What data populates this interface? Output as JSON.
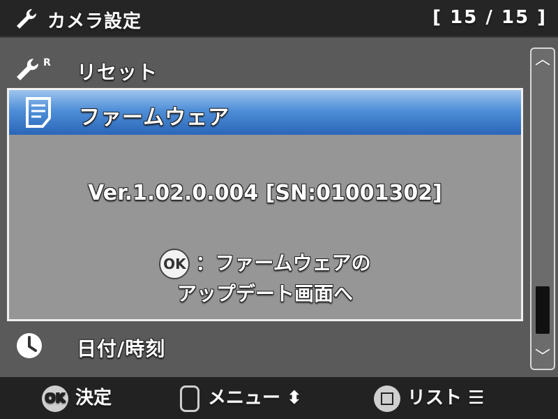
{
  "header": {
    "title": "カメラ設定",
    "page_indicator": "[ 15 / 15 ]"
  },
  "menu": {
    "items": [
      {
        "label": "リセット",
        "icon": "wrench-reset-icon"
      },
      {
        "label": "ファームウェア",
        "icon": "firmware-icon",
        "selected": true
      },
      {
        "label": "日付/時刻",
        "icon": "clock-icon"
      }
    ],
    "superscript_R": "R"
  },
  "detail": {
    "version": "Ver.1.02.0.004 [SN:01001302]",
    "ok_badge": "OK",
    "hint_line1": "：ファームウェアの",
    "hint_line2": "アップデート画面へ"
  },
  "footer": {
    "ok_badge": "OK",
    "ok_label": "決定",
    "menu_label": "メニュー",
    "menu_arrow": "⬍",
    "list_label": "リスト",
    "list_icon": "☰"
  },
  "colors": {
    "highlight": "#4f8fd8",
    "panel": "#969696",
    "background": "#5a5a5a",
    "bar": "#222222"
  }
}
